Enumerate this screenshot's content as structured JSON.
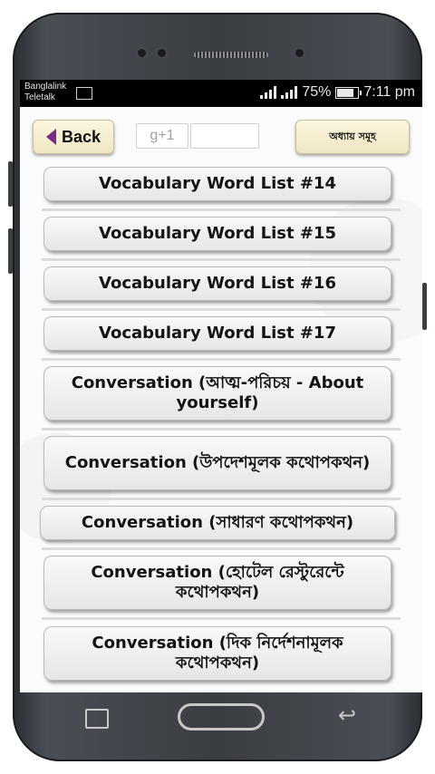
{
  "status": {
    "carrier1": "Banglalink",
    "carrier2": "Teletalk",
    "battery": "75%",
    "time": "7:11 pm"
  },
  "toolbar": {
    "back_label": "Back",
    "gplus_label": "g+1",
    "gplus_count": "",
    "chapters_label": "অধ্যায় সমূহ"
  },
  "items": [
    {
      "label": "Vocabulary Word List #14"
    },
    {
      "label": "Vocabulary Word List #15"
    },
    {
      "label": "Vocabulary Word List #16"
    },
    {
      "label": "Vocabulary Word List #17"
    },
    {
      "label": "Conversation (আত্ম-পরিচয় - About yourself)"
    },
    {
      "label": "Conversation (উপদেশমূলক কথোপকথন)"
    },
    {
      "label": "Conversation (সাধারণ কথোপকথন)"
    },
    {
      "label": "Conversation (হোটেল রেস্টুরেন্টে কথোপকথন)"
    },
    {
      "label": "Conversation (দিক নির্দেশনামূলক কথোপকথন)"
    }
  ],
  "icons": {
    "back": "back-triangle-icon",
    "recent": "recent-apps-icon",
    "home": "home-icon",
    "nav_back": "return-arrow-icon"
  }
}
